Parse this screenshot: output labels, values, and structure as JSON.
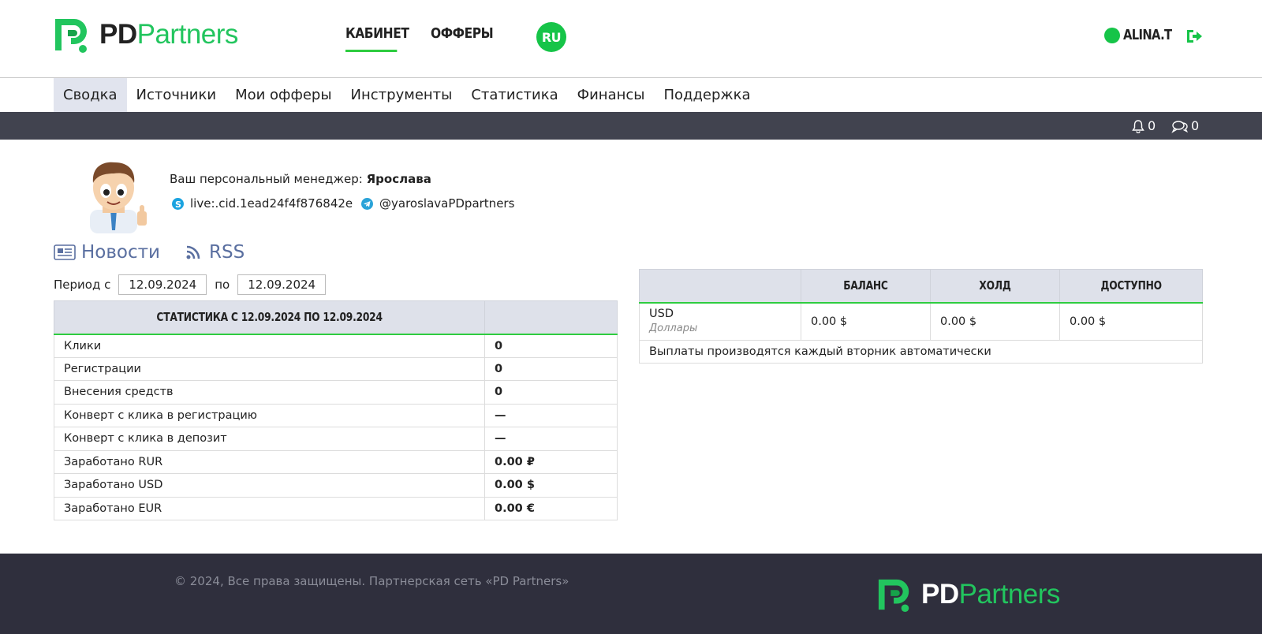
{
  "brand": {
    "name_bold": "PD",
    "name_light": "Partners",
    "color": "#22c55e"
  },
  "header": {
    "nav": [
      {
        "label": "КАБИНЕТ"
      },
      {
        "label": "ОФФЕРЫ"
      }
    ],
    "lang": "RU",
    "user": "ALINA.T",
    "icons": {
      "logout": "logout-icon",
      "status": "online-dot"
    }
  },
  "subnav": [
    "Сводка",
    "Источники",
    "Мои офферы",
    "Инструменты",
    "Статистика",
    "Финансы",
    "Поддержка"
  ],
  "notifications": {
    "bell_count": "0",
    "messages_count": "0"
  },
  "manager": {
    "label": "Ваш персональный менеджер:",
    "name": "Ярослава",
    "skype": "live:.cid.1ead24f4f876842e",
    "telegram": "@yaroslavaPDpartners"
  },
  "news": {
    "news_label": "Новости",
    "rss_label": "RSS"
  },
  "period": {
    "from_label": "Период с",
    "from": "12.09.2024",
    "to_label": "по",
    "to": "12.09.2024"
  },
  "stats": {
    "header": "СТАТИСТИКА С 12.09.2024 ПО 12.09.2024",
    "rows": [
      {
        "label": "Клики",
        "value": "0"
      },
      {
        "label": "Регистрации",
        "value": "0"
      },
      {
        "label": "Внесения средств",
        "value": "0"
      },
      {
        "label": "Конверт с клика в регистрацию",
        "value": "—"
      },
      {
        "label": "Конверт с клика в депозит",
        "value": "—"
      },
      {
        "label": "Заработано RUR",
        "value": "0.00 ₽"
      },
      {
        "label": "Заработано USD",
        "value": "0.00 $"
      },
      {
        "label": "Заработано EUR",
        "value": "0.00 €"
      }
    ]
  },
  "balance": {
    "headers": [
      "",
      "БАЛАНС",
      "ХОЛД",
      "ДОСТУПНО"
    ],
    "currency": "USD",
    "currency_name": "Доллары",
    "balance": "0.00 $",
    "hold": "0.00 $",
    "available": "0.00 $",
    "note": "Выплаты производятся каждый вторник автоматически"
  },
  "footer": {
    "copyright": "© 2024, Все права защищены. Партнерская сеть «PD Partners»"
  }
}
